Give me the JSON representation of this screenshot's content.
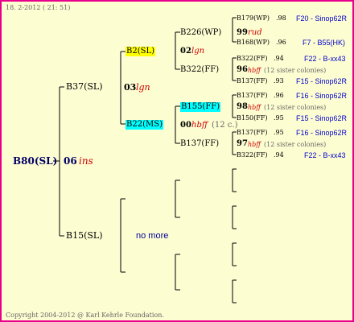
{
  "header": "18. 2-2012 ( 21: 51)",
  "footer": "Copyright 2004-2012 @ Karl Kehrle Foundation.",
  "colors": {
    "border": "#e8008c",
    "bg": "#fdfdd2",
    "yellow": "#ffff00",
    "cyan": "#00ffff",
    "red": "#cc0000",
    "blue": "#0000cc"
  },
  "root": {
    "name": "B80(SL)",
    "year": "06",
    "tag": "ins"
  },
  "gen1": {
    "top": {
      "name": "B37(SL)",
      "year": "03",
      "tag": "lgn"
    },
    "bottom": {
      "name": "B15(SL)",
      "text": "no more"
    }
  },
  "gen2": {
    "a": {
      "name": "B2(SL)",
      "year": "02",
      "tag": "lgn"
    },
    "b": {
      "name": "B22(MS)",
      "year": "00",
      "tag": "hbff",
      "extra": "(12 c.)"
    }
  },
  "gen3": {
    "a1": {
      "name": "B226(WP)",
      "year": "99",
      "tag": "rud"
    },
    "a2": {
      "name": "B322(FF)"
    },
    "b1": {
      "name": "B155(FF)",
      "year": "98",
      "tag": "hbff",
      "extra": "(12 sister colonies)"
    },
    "b2": {
      "name": "B137(FF)",
      "year": "97",
      "tag": "hbff",
      "extra": "(12 sister colonies)"
    }
  },
  "gen4": [
    {
      "name": "B179(WP)",
      "val": ".98",
      "src": "F20 - Sinop62R"
    },
    {
      "name": "B168(WP)",
      "val": ".96",
      "src": "F7 - B55(HK)"
    },
    {
      "name": "B322(FF)",
      "val": ".94",
      "src": "F22 - B-xx43"
    },
    {
      "name": "B137(FF)",
      "val": ".93",
      "src": "F15 - Sinop62R"
    },
    {
      "name": "B137(FF)",
      "val": ".96",
      "src": "F16 - Sinop62R"
    },
    {
      "name": "B150(FF)",
      "val": ".95",
      "src": "F15 - Sinop62R"
    },
    {
      "name": "B137(FF)",
      "val": ".95",
      "src": "F16 - Sinop62R"
    },
    {
      "name": "B322(FF)",
      "val": ".94",
      "src": "F22 - B-xx43"
    }
  ],
  "mid3": {
    "year": "96",
    "tag": "hbff",
    "extra": "(12 sister colonies)"
  }
}
